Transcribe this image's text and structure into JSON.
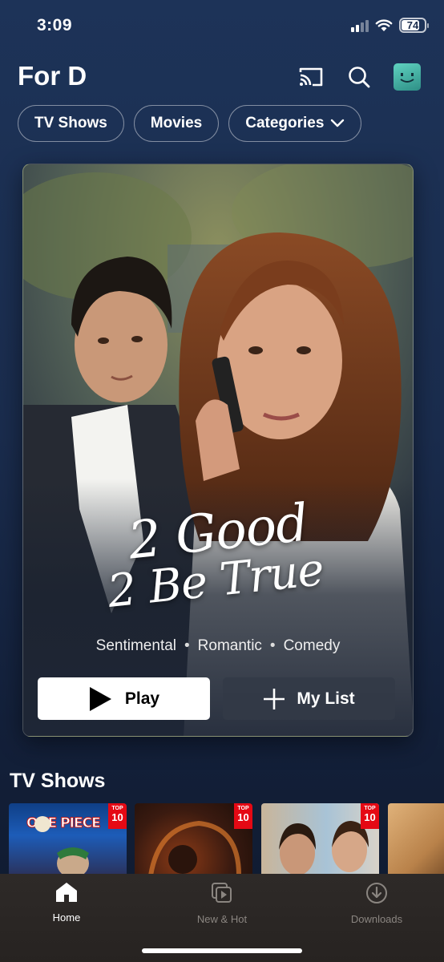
{
  "status_bar": {
    "time": "3:09",
    "battery": "74"
  },
  "header": {
    "profile_title": "For D",
    "cast_icon": "cast-icon",
    "search_icon": "search-icon",
    "avatar_icon": "profile-avatar-icon"
  },
  "filters": {
    "tv_shows": "TV Shows",
    "movies": "Movies",
    "categories": "Categories"
  },
  "hero": {
    "title_line1": "2 Good",
    "title_line2": "2 Be True",
    "tags": [
      "Sentimental",
      "Romantic",
      "Comedy"
    ],
    "tag_separator": "•",
    "play_label": "Play",
    "my_list_label": "My List"
  },
  "rows": {
    "tv_shows": {
      "title": "TV Shows",
      "posters": [
        {
          "badge_top": "TOP",
          "badge_num": "10",
          "logo_text": "ONE PIECE"
        },
        {
          "badge_top": "TOP",
          "badge_num": "10"
        },
        {
          "badge_top": "TOP",
          "badge_num": "10"
        },
        {}
      ]
    }
  },
  "tabbar": {
    "home": "Home",
    "new_hot": "New & Hot",
    "downloads": "Downloads"
  },
  "colors": {
    "background": "#1a2c4d",
    "netflix_red": "#e50914",
    "tabbar": "#2a2624"
  }
}
